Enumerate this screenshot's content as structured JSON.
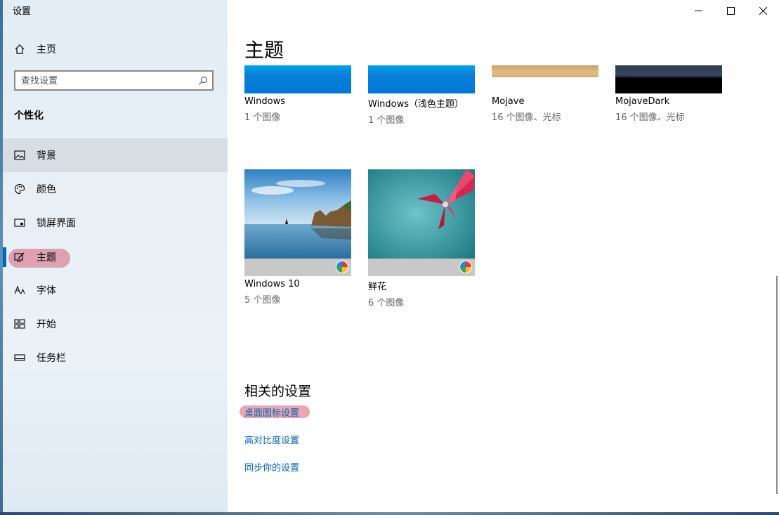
{
  "window": {
    "title": "设置",
    "minimize_glyph": "—",
    "maximize_glyph": "☐",
    "close_glyph": "✕"
  },
  "sidebar": {
    "home_label": "主页",
    "search_placeholder": "查找设置",
    "section_heading": "个性化",
    "items": [
      {
        "label": "背景",
        "icon": "picture-icon"
      },
      {
        "label": "颜色",
        "icon": "palette-icon"
      },
      {
        "label": "锁屏界面",
        "icon": "lock-screen-icon"
      },
      {
        "label": "主题",
        "icon": "theme-brush-icon"
      },
      {
        "label": "字体",
        "icon": "font-icon"
      },
      {
        "label": "开始",
        "icon": "start-grid-icon"
      },
      {
        "label": "任务栏",
        "icon": "taskbar-icon"
      }
    ]
  },
  "main": {
    "title": "主题",
    "themes": [
      {
        "name": "Windows",
        "count": "1 个图像"
      },
      {
        "name": "Windows（浅色主题）",
        "count": "1 个图像"
      },
      {
        "name": "Mojave",
        "count": "16 个图像、光标"
      },
      {
        "name": "MojaveDark",
        "count": "16 个图像、光标"
      },
      {
        "name": "Windows 10",
        "count": "5 个图像"
      },
      {
        "name": "鲜花",
        "count": "6 个图像"
      }
    ],
    "related_heading": "相关的设置",
    "related_links": [
      "桌面图标设置",
      "高对比度设置",
      "同步你的设置"
    ]
  },
  "colors": {
    "accent": "#0078d7",
    "link": "#0063b1",
    "marker": "#d65f78"
  }
}
